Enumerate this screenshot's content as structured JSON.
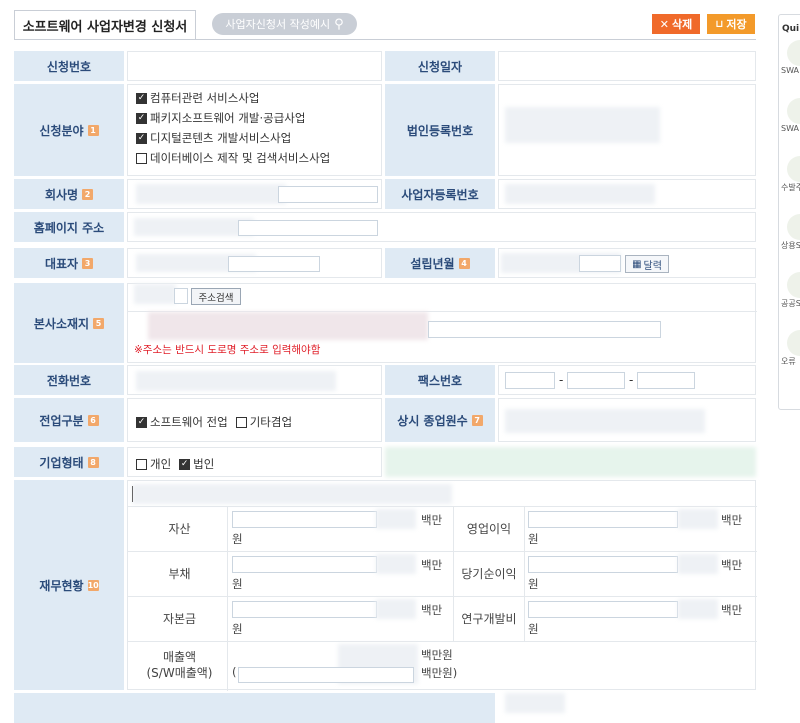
{
  "tab": {
    "title": "소프트웨어 사업자변경 신청서"
  },
  "guide": {
    "label": "사업자신청서 작성예시"
  },
  "toolbar": {
    "delete": "삭제",
    "save": "저장"
  },
  "colors": {
    "accent_orange": "#f39a2a",
    "label_bg": "#dfeaf4",
    "label_text": "#2b4b7a",
    "notice_red": "#e0202a"
  },
  "labels": {
    "request_no": "신청번호",
    "request_date": "신청일자",
    "field": "신청분야",
    "corp_reg": "법인등록번호",
    "company": "회사명",
    "biz_reg": "사업자등록번호",
    "homepage": "홈페이지 주소",
    "ceo": "대표자",
    "founded": "설립년월",
    "address": "본사소재지",
    "phone": "전화번호",
    "fax": "팩스번호",
    "specialty": "전업구분",
    "employees": "상시 종업원수",
    "biz_type": "기업형태",
    "finance": "재무현황"
  },
  "badges": {
    "field": "1",
    "company": "2",
    "ceo": "3",
    "founded": "4",
    "address": "5",
    "specialty": "6",
    "employees": "7",
    "biz_type": "8",
    "finance": "10"
  },
  "field_options": [
    {
      "label": "컴퓨터관련 서비스사업",
      "checked": true
    },
    {
      "label": "패키지소프트웨어 개발·공급사업",
      "checked": true
    },
    {
      "label": "디지털콘텐츠 개발서비스사업",
      "checked": true
    },
    {
      "label": "데이터베이스 제작 및 검색서비스사업",
      "checked": false
    }
  ],
  "calendar_button": "달력",
  "address_search": "주소검색",
  "address_notice": "※주소는 반드시 도로명 주소로 입력해야함",
  "fax_sep": "-",
  "specialty_options": [
    {
      "label": "소프트웨어 전업",
      "checked": true
    },
    {
      "label": "기타겸업",
      "checked": false
    }
  ],
  "biz_type_options": [
    {
      "label": "개인",
      "checked": false
    },
    {
      "label": "법인",
      "checked": true
    }
  ],
  "finance": {
    "rows": [
      {
        "left_label": "자산",
        "right_label": "영업이익"
      },
      {
        "left_label": "부채",
        "right_label": "당기순이익"
      },
      {
        "left_label": "자본금",
        "right_label": "연구개발비"
      }
    ],
    "unit_a": "백만",
    "unit_b": "원",
    "sales_label": "매출액",
    "sales_sub": "(S/W매출액)",
    "sales_open": "(",
    "sales_unit": "백만원",
    "sales_unit2": "백만원)"
  },
  "quick": {
    "title": "Qui",
    "items": [
      "SWA",
      "SWA",
      "수발주",
      "상용S",
      "공공S",
      "오류"
    ]
  }
}
